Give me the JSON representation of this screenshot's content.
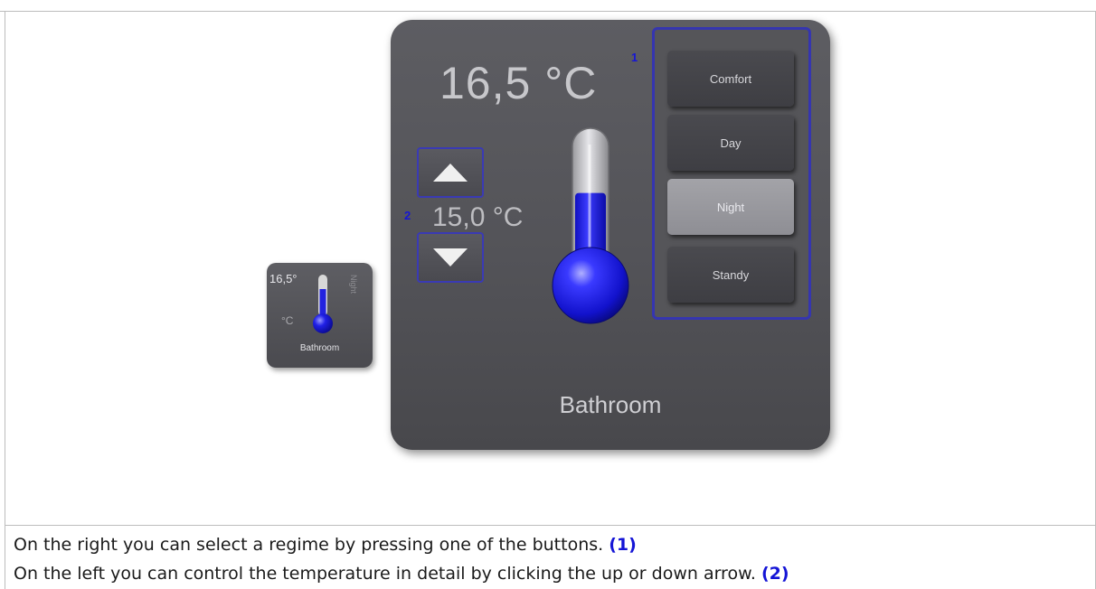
{
  "panel": {
    "current_temp": "16,5 °C",
    "setpoint": "15,0 °C",
    "room": "Bathroom",
    "marker_regimes": "1",
    "marker_setpoint": "2",
    "thermometer_level": 0.62,
    "colors": {
      "panel": "#535358",
      "accent_blue": "#1515d6",
      "frame": "#3535b0",
      "mercury": "#1a1ae6"
    }
  },
  "regimes": [
    {
      "label": "Comfort",
      "active": false
    },
    {
      "label": "Day",
      "active": false
    },
    {
      "label": "Night",
      "active": true
    },
    {
      "label": "Standy",
      "active": false
    }
  ],
  "mini_widget": {
    "temp": "16,5°",
    "unit": "°C",
    "mode": "Night",
    "room": "Bathroom"
  },
  "description": {
    "line1": "On the right you can select a regime by pressing one of the buttons.",
    "ref1": "(1)",
    "line2": "On the left you can control the temperature in detail by clicking the up or down arrow.",
    "ref2": "(2)"
  },
  "icons": {
    "up": "arrow-up-icon",
    "down": "arrow-down-icon",
    "thermometer": "thermometer-icon"
  }
}
